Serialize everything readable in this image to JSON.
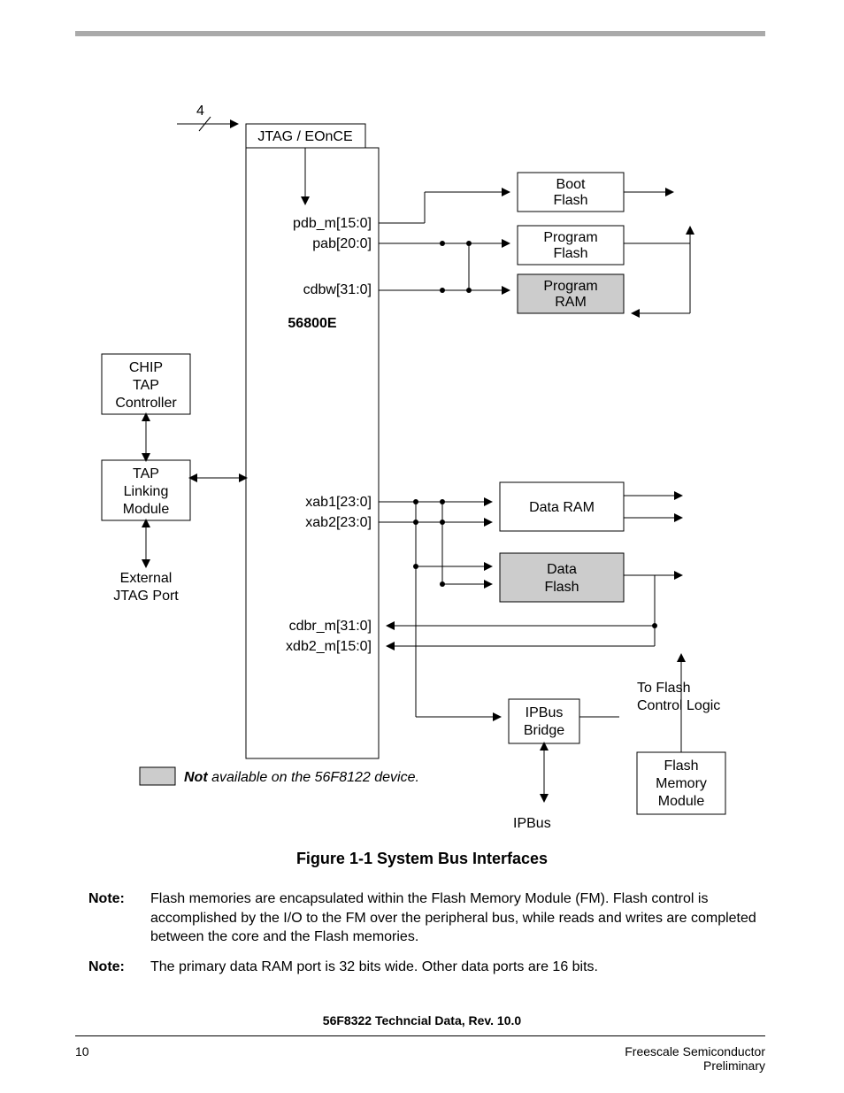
{
  "diagram": {
    "bus_width_label": "4",
    "jtag_eonce": "JTAG / EOnCE",
    "core_label": "56800E",
    "core_signals": {
      "pdb_m": "pdb_m[15:0]",
      "pab": "pab[20:0]",
      "cdbw": "cdbw[31:0]",
      "xab1": "xab1[23:0]",
      "xab2": "xab2[23:0]",
      "cdbr_m": "cdbr_m[31:0]",
      "xdb2_m": "xdb2_m[15:0]"
    },
    "left_blocks": {
      "chip_tap_l1": "CHIP",
      "chip_tap_l2": "TAP",
      "chip_tap_l3": "Controller",
      "tap_link_l1": "TAP",
      "tap_link_l2": "Linking",
      "tap_link_l3": "Module",
      "ext_jtag_l1": "External",
      "ext_jtag_l2": "JTAG Port"
    },
    "right_blocks": {
      "boot_flash_l1": "Boot",
      "boot_flash_l2": "Flash",
      "prog_flash_l1": "Program",
      "prog_flash_l2": "Flash",
      "prog_ram_l1": "Program",
      "prog_ram_l2": "RAM",
      "data_ram": "Data RAM",
      "data_flash_l1": "Data",
      "data_flash_l2": "Flash",
      "ipbus_bridge_l1": "IPBus",
      "ipbus_bridge_l2": "Bridge",
      "flash_mm_l1": "Flash",
      "flash_mm_l2": "Memory",
      "flash_mm_l3": "Module"
    },
    "annotations": {
      "to_flash_l1": "To Flash",
      "to_flash_l2": "Control Logic",
      "ipbus": "IPBus"
    },
    "legend": {
      "not_word": "Not",
      "rest": " available on the 56F8122 device."
    }
  },
  "caption": "Figure 1-1 System Bus Interfaces",
  "notes": {
    "label": "Note:",
    "n1": "Flash memories are encapsulated within the Flash Memory Module (FM). Flash control is accomplished by the I/O to the FM over the peripheral bus, while reads and writes are completed between the core and the Flash memories.",
    "n2": "The primary data RAM port is 32 bits wide. Other data ports are 16 bits."
  },
  "footer": {
    "doc": "56F8322 Techncial Data, Rev. 10.0",
    "page": "10",
    "company": "Freescale Semiconductor",
    "status": "Preliminary"
  }
}
